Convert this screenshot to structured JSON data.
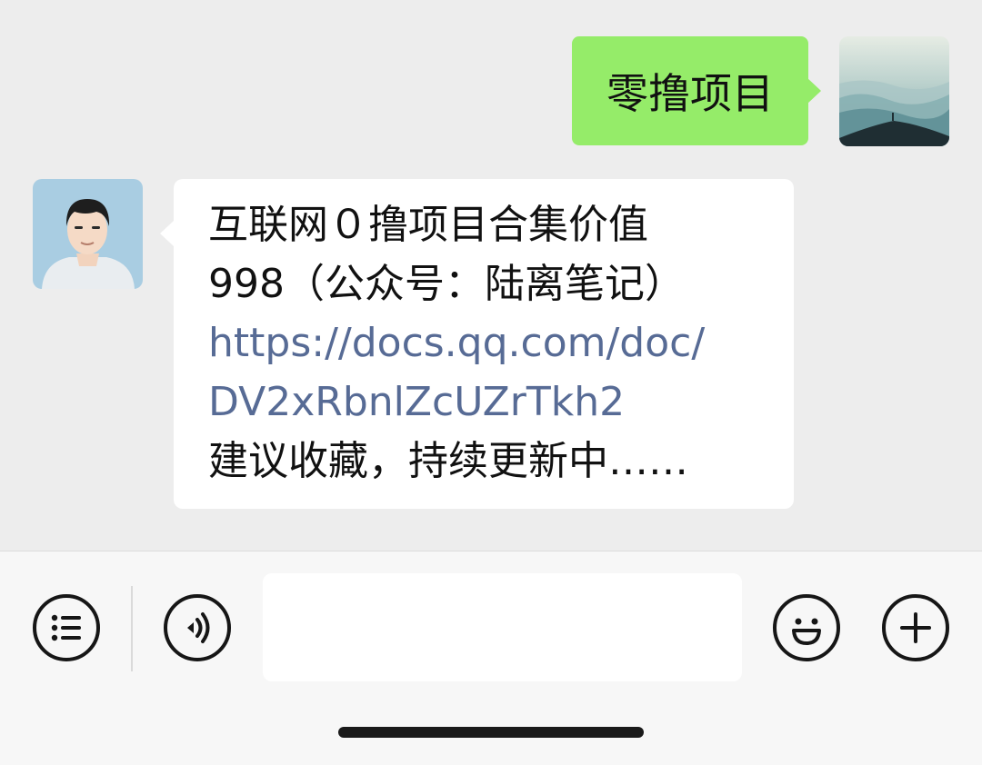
{
  "messages": {
    "outgoing": {
      "text": "零撸项目",
      "avatar_icon": "landscape-avatar",
      "bubble_color": "#95ec69"
    },
    "incoming": {
      "avatar_icon": "person-avatar",
      "line1": "互联网０撸项目合集价值",
      "line2": "998（公众号：陆离笔记）",
      "link_line1": "https://docs.qq.com/doc/",
      "link_line2": "DV2xRbnlZcUZrTkh2",
      "line5": "建议收藏，持续更新中……",
      "link_color": "#576b95"
    }
  },
  "input_bar": {
    "menu_icon": "list-icon",
    "voice_icon": "voice-icon",
    "emoji_icon": "emoji-icon",
    "more_icon": "plus-icon",
    "input_value": ""
  }
}
